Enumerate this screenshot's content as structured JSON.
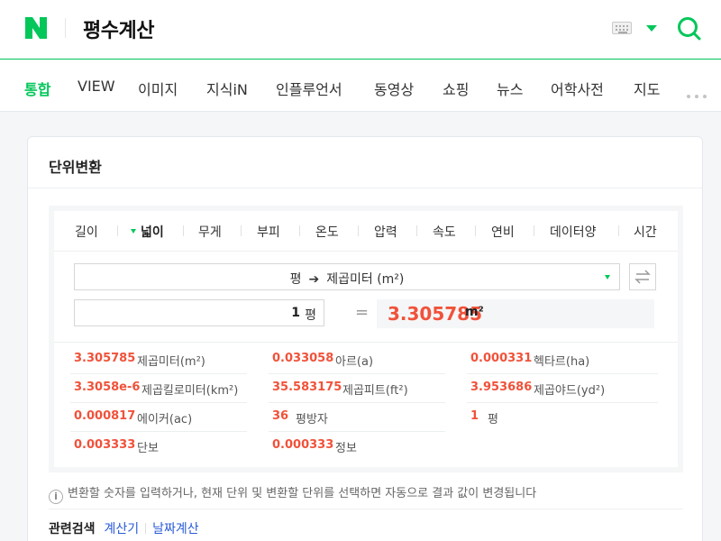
{
  "header": {
    "query": "평수계산",
    "colors": {
      "brand": "#03c75a",
      "result": "#f0523a",
      "link": "#2a5bd7"
    }
  },
  "nav": {
    "items": [
      "통합",
      "VIEW",
      "이미지",
      "지식iN",
      "인플루언서",
      "동영상",
      "쇼핑",
      "뉴스",
      "어학사전",
      "지도"
    ],
    "active": "통합"
  },
  "card": {
    "title": "단위변환"
  },
  "converter": {
    "tabs": [
      "길이",
      "넓이",
      "무게",
      "부피",
      "온도",
      "압력",
      "속도",
      "연비",
      "데이터양",
      "시간"
    ],
    "active_tab": "넓이",
    "select": {
      "from": "평",
      "to": "제곱미터 (m²)"
    },
    "input": {
      "value": "1",
      "unit": "평"
    },
    "equals": "=",
    "result": {
      "value": "3.305785",
      "unit": "m²"
    },
    "conversions": [
      {
        "value": "3.305785",
        "unit": "제곱미터(m²)"
      },
      {
        "value": "0.033058",
        "unit": "아르(a)"
      },
      {
        "value": "0.000331",
        "unit": "헥타르(ha)"
      },
      {
        "value": "3.3058e-6",
        "unit": "제곱킬로미터(km²)"
      },
      {
        "value": "35.583175",
        "unit": "제곱피트(ft²)"
      },
      {
        "value": "3.953686",
        "unit": "제곱야드(yd²)"
      },
      {
        "value": "0.000817",
        "unit": "에이커(ac)"
      },
      {
        "value": "36",
        "unit": "평방자"
      },
      {
        "value": "1",
        "unit": "평"
      },
      {
        "value": "0.003333",
        "unit": "단보"
      },
      {
        "value": "0.000333",
        "unit": "정보"
      }
    ]
  },
  "info": {
    "icon": "i",
    "text": "변환할 숫자를 입력하거나, 현재 단위 및 변환할 단위를 선택하면 자동으로 결과 값이 변경됩니다"
  },
  "related": {
    "title": "관련검색",
    "links": [
      "계산기",
      "날짜계산"
    ]
  }
}
